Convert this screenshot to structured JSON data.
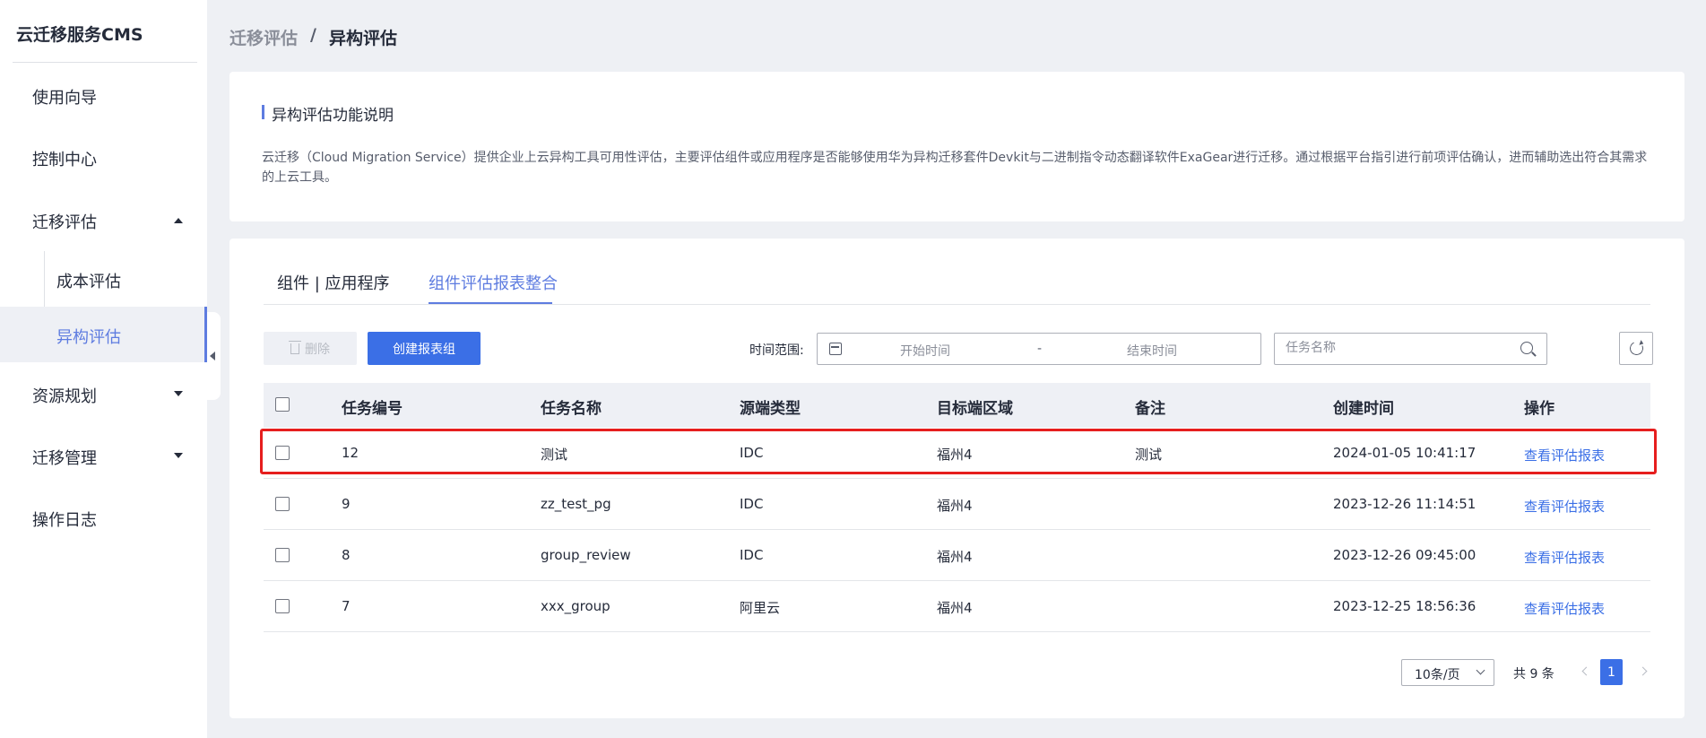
{
  "app": {
    "title": "云迁移服务CMS"
  },
  "sidebar": {
    "items": [
      {
        "label": "使用向导"
      },
      {
        "label": "控制中心"
      },
      {
        "label": "迁移评估",
        "children": [
          {
            "label": "成本评估"
          },
          {
            "label": "异构评估",
            "active": true
          }
        ]
      },
      {
        "label": "资源规划"
      },
      {
        "label": "迁移管理"
      },
      {
        "label": "操作日志"
      }
    ]
  },
  "breadcrumb": {
    "parent": "迁移评估",
    "separator": "/",
    "current": "异构评估"
  },
  "info": {
    "title": "异构评估功能说明",
    "description": "云迁移（Cloud Migration Service）提供企业上云异构工具可用性评估，主要评估组件或应用程序是否能够使用华为异构迁移套件Devkit与二进制指令动态翻译软件ExaGear进行迁移。通过根据平台指引进行前项评估确认，进而辅助选出符合其需求的上云工具。"
  },
  "tabs": [
    {
      "label": "组件 | 应用程序"
    },
    {
      "label": "组件评估报表整合",
      "active": true
    }
  ],
  "toolbar": {
    "delete_label": "删除",
    "create_label": "创建报表组",
    "time_range_label": "时间范围:",
    "start_placeholder": "开始时间",
    "range_separator": "-",
    "end_placeholder": "结束时间",
    "search_placeholder": "任务名称"
  },
  "table": {
    "columns": [
      "任务编号",
      "任务名称",
      "源端类型",
      "目标端区域",
      "备注",
      "创建时间",
      "操作"
    ],
    "rows": [
      {
        "id": "12",
        "name": "测试",
        "source": "IDC",
        "region": "福州4",
        "note": "测试",
        "created": "2024-01-05 10:41:17",
        "action": "查看评估报表"
      },
      {
        "id": "9",
        "name": "zz_test_pg",
        "source": "IDC",
        "region": "福州4",
        "note": "",
        "created": "2023-12-26 11:14:51",
        "action": "查看评估报表"
      },
      {
        "id": "8",
        "name": "group_review",
        "source": "IDC",
        "region": "福州4",
        "note": "",
        "created": "2023-12-26 09:45:00",
        "action": "查看评估报表"
      },
      {
        "id": "7",
        "name": "xxx_group",
        "source": "阿里云",
        "region": "福州4",
        "note": "",
        "created": "2023-12-25 18:56:36",
        "action": "查看评估报表"
      }
    ]
  },
  "pagination": {
    "page_size": "10条/页",
    "total": "共 9 条",
    "current_page": "1"
  },
  "colors": {
    "accent": "#5e7ce0",
    "primary_button": "#3b6fe6",
    "highlight_border": "#e61e1e"
  }
}
